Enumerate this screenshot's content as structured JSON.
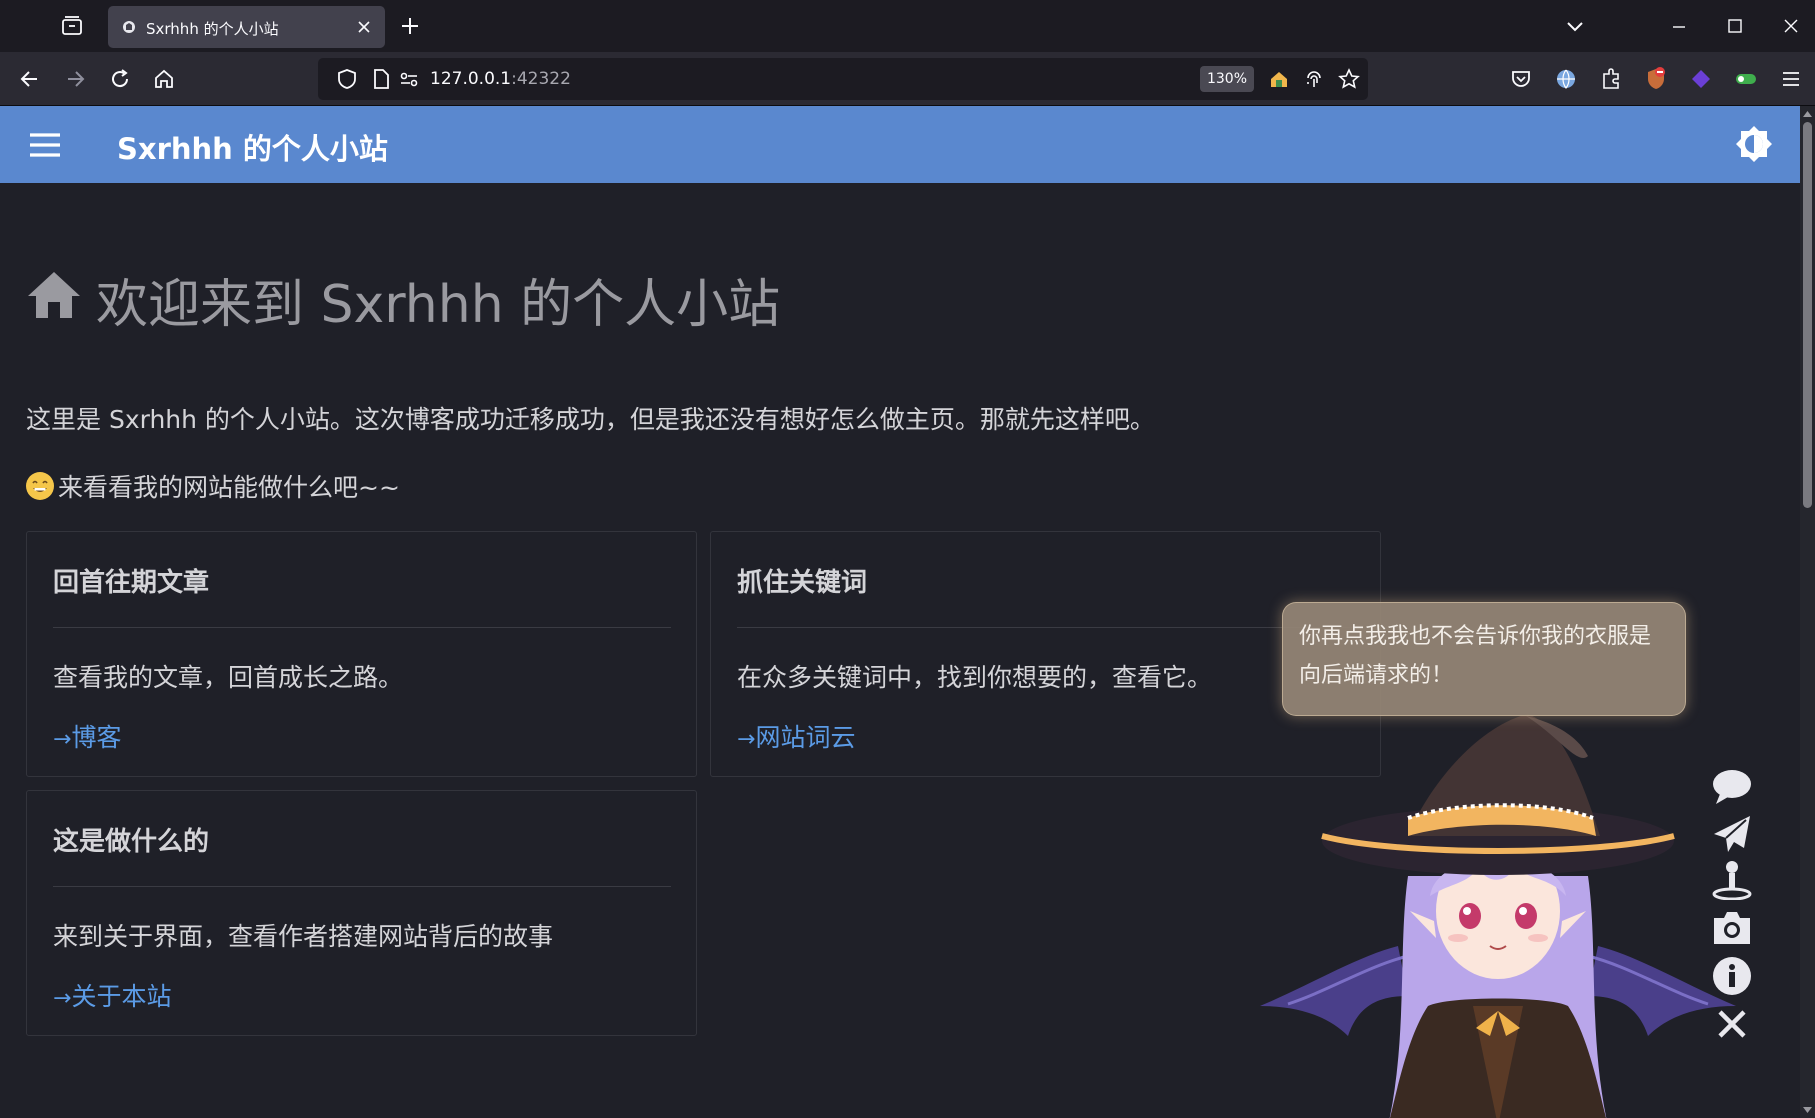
{
  "browser": {
    "tab_title": "Sxrhhh 的个人小站",
    "url_host": "127.0.0.1",
    "url_port": ":42322",
    "zoom": "130%"
  },
  "site": {
    "title": "Sxrhhh 的个人小站"
  },
  "main": {
    "heading": "欢迎来到 Sxrhhh 的个人小站",
    "intro": "这里是 Sxrhhh 的个人小站。这次博客成功迁移成功，但是我还没有想好怎么做主页。那就先这样吧。",
    "cta": "来看看我的网站能做什么吧~~",
    "cards": [
      {
        "title": "回首往期文章",
        "desc": "查看我的文章，回首成长之路。",
        "link": "博客"
      },
      {
        "title": "抓住关键词",
        "desc": "在众多关键词中，找到你想要的，查看它。",
        "link": "网站词云"
      },
      {
        "title": "这是做什么的",
        "desc": "来到关于界面，查看作者搭建网站背后的故事",
        "link": "关于本站"
      }
    ]
  },
  "widget": {
    "bubble": "你再点我我也不会告诉你我的衣服是向后端请求的！",
    "tools": [
      "chat-icon",
      "send-icon",
      "user-icon",
      "camera-icon",
      "info-icon",
      "close-icon"
    ]
  },
  "colors": {
    "appbar": "#5a88cf",
    "link": "#5b9be6",
    "background": "#1f2028"
  }
}
